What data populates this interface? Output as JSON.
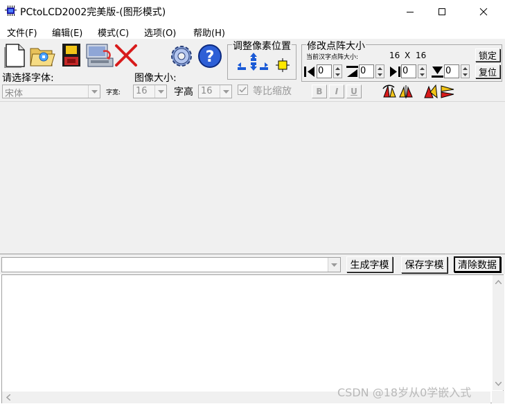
{
  "window": {
    "title": "PCtoLCD2002完美版-(图形模式)",
    "icon": "app-chip-icon",
    "controls": [
      "minimize-icon",
      "maximize-icon",
      "close-icon"
    ]
  },
  "menu": [
    "文件(F)",
    "编辑(E)",
    "模式(C)",
    "选项(O)",
    "帮助(H)"
  ],
  "toolbar": {
    "icons": [
      "new-file-icon",
      "open-folder-icon",
      "save-disk-icon",
      "export-icon",
      "delete-x-icon",
      "settings-gear-icon",
      "help-icon"
    ]
  },
  "pixel_adjust": {
    "title": "调整像素位置",
    "icons": [
      "shift-up-icon",
      "shift-left-icon",
      "shift-right-icon",
      "shift-down-icon",
      "center-icon"
    ]
  },
  "dot_matrix": {
    "title": "修改点阵大小",
    "current_label": "当前汉字点阵大小:",
    "width": "16",
    "x": "X",
    "height": "16",
    "lock_label": "锁定",
    "reset_label": "复位",
    "spinners": [
      {
        "icon": "pad-left-icon",
        "value": "0"
      },
      {
        "icon": "pad-top-icon",
        "value": "0"
      },
      {
        "icon": "pad-right-icon",
        "value": "0"
      },
      {
        "icon": "pad-bottom-icon",
        "value": "0"
      }
    ]
  },
  "font": {
    "prompt": "请选择字体:",
    "value": "宋体",
    "width_label": "字宽:",
    "width_value": "16",
    "height_label": "字高",
    "height_value": "16"
  },
  "image_size": {
    "label": "图像大小:",
    "keep_ratio_label": "等比缩放",
    "keep_ratio_checked": true
  },
  "style_buttons": [
    "B",
    "I",
    "U"
  ],
  "transform_icons": [
    "rotate-icon",
    "mirror-icon",
    "invert-icon",
    "flip-icon"
  ],
  "input": {
    "text": "",
    "generate_label": "生成字模",
    "save_label": "保存字模",
    "clear_label": "清除数据"
  },
  "output": {
    "text": ""
  },
  "watermark": "CSDN @18岁从0学嵌入式",
  "colors": {
    "panel": "#f0f0f0",
    "title_bg": "#ffffff"
  }
}
